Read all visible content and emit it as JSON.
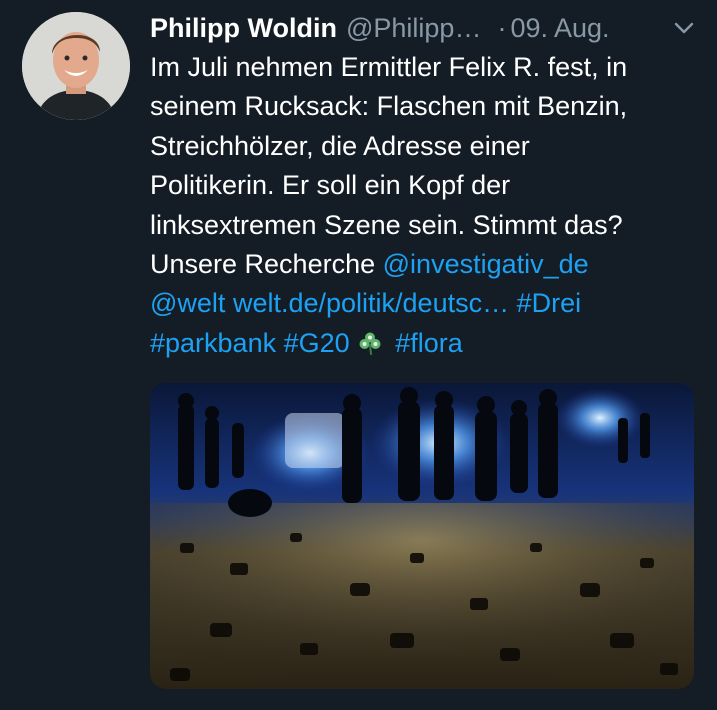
{
  "author": {
    "name": "Philipp Woldin",
    "handle": "@Philipp…",
    "separator": "·",
    "date": "09. Aug."
  },
  "icons": {
    "avatar": "profile-photo",
    "more": "chevron-down-icon",
    "emoji": "shamrock-icon"
  },
  "tweet": {
    "line1": "Im Juli nehmen Ermittler Felix R. fest, in",
    "line2": "seinem Rucksack: Flaschen mit Benzin,",
    "line3": "Streichhölzer, die Adresse einer",
    "line4": "Politikerin. Er soll ein Kopf der",
    "line5": "linksextremen Szene sein. Stimmt das?",
    "line6_text": "Unsere Recherche",
    "mention_investigativ": "@investigativ_de",
    "mention_welt": "@welt",
    "url": "welt.de/politik/deutsc…",
    "hashtag_drei": "#Drei",
    "hashtag_parkbank": "#parkbank",
    "hashtag_g20": "#G20",
    "hashtag_flora": "#flora"
  },
  "colors": {
    "background": "#141d26",
    "text": "#ffffff",
    "muted": "#8899a6",
    "link": "#1da1f2"
  }
}
